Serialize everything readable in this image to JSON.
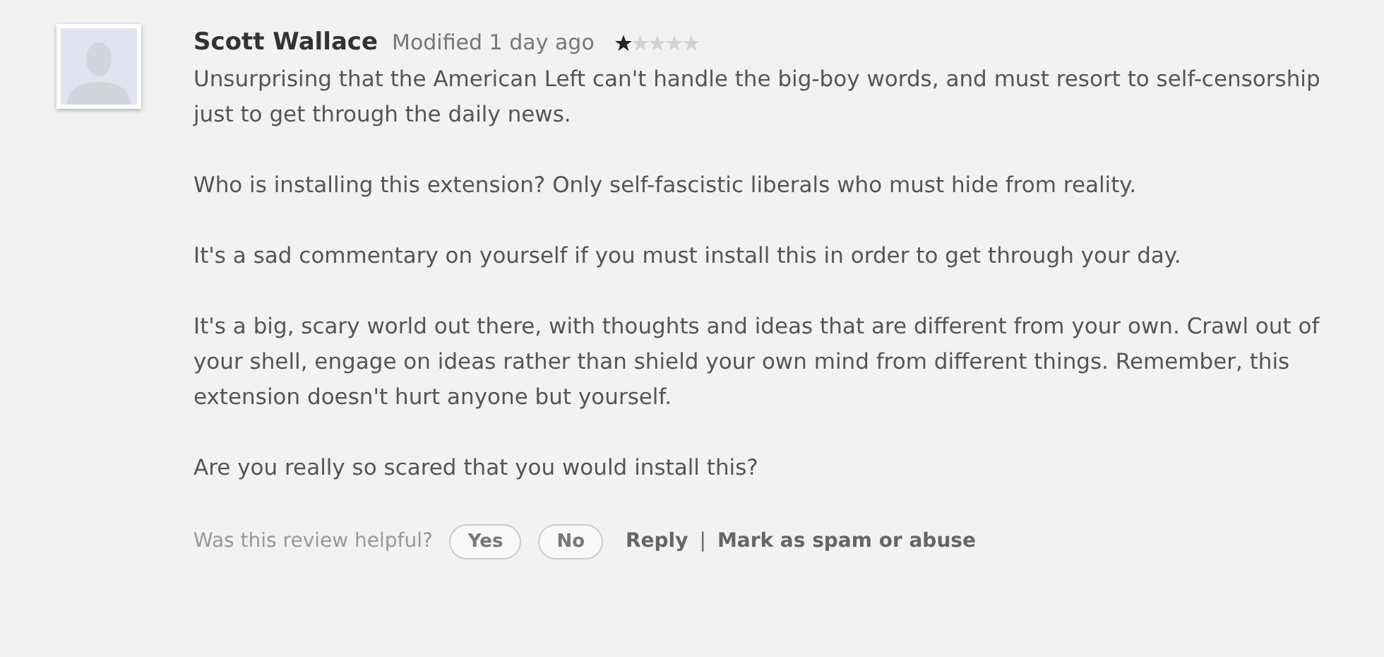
{
  "review": {
    "author": "Scott Wallace",
    "modified": "Modified 1 day ago",
    "stars": 1,
    "paragraphs": [
      "Unsurprising that the American Left can't handle the big-boy words, and must resort to self-censorship just to get through the daily news.",
      "Who is installing this extension? Only self-fascistic liberals who must hide from reality.",
      "It's a sad commentary on yourself if you must install this in order to get through your day.",
      "It's a big, scary world out there, with thoughts and ideas that are different from your own. Crawl out of your shell, engage on ideas rather than shield your own mind from different things. Remember, this extension doesn't hurt anyone but yourself.",
      "Are you really so scared that you would install this?"
    ]
  },
  "footer": {
    "question": "Was this review helpful?",
    "buttons": [
      "Yes",
      "No"
    ],
    "links": [
      "Reply",
      "Mark as spam or abuse"
    ],
    "separator": "|"
  }
}
